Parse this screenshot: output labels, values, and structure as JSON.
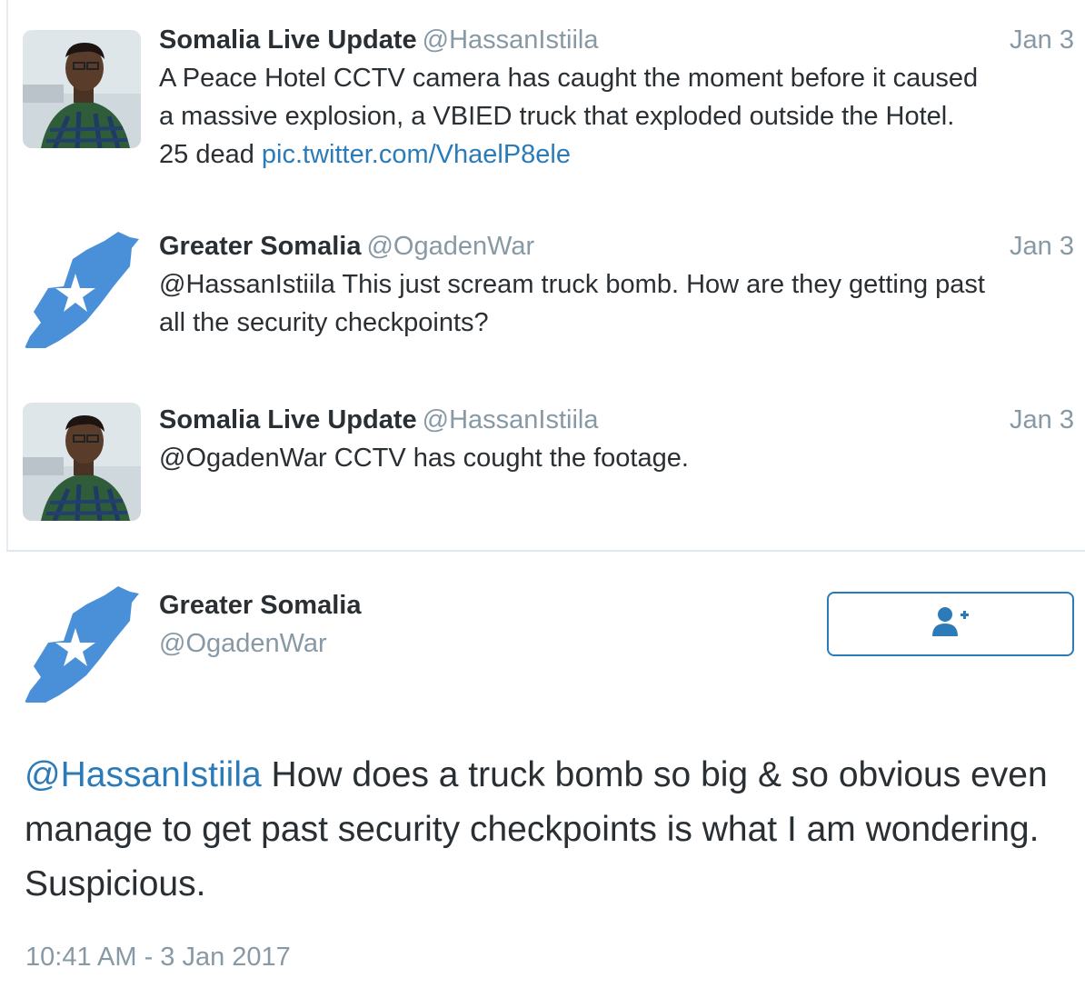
{
  "thread": [
    {
      "name": "Somalia Live Update",
      "handle": "@HassanIstiila",
      "date": "Jan 3",
      "text_lines": [
        "A Peace Hotel CCTV camera has caught the moment before it caused",
        "a massive explosion, a VBIED truck that exploded outside the Hotel.",
        "25 dead "
      ],
      "link": "pic.twitter.com/VhaelP8ele",
      "avatar": "user-photo-avatar"
    },
    {
      "name": "Greater Somalia",
      "handle": "@OgadenWar",
      "date": "Jan 3",
      "text_lines": [
        "@HassanIstiila This just scream truck bomb. How are they getting past",
        "all the security checkpoints?"
      ],
      "avatar": "somalia-map-flag-avatar"
    },
    {
      "name": "Somalia Live Update",
      "handle": "@HassanIstiila",
      "date": "Jan 3",
      "text_lines": [
        "@OgadenWar CCTV has cought the footage."
      ],
      "avatar": "user-photo-avatar"
    }
  ],
  "main_tweet": {
    "name": "Greater Somalia",
    "handle": "@OgadenWar",
    "mention": "@HassanIstiila",
    "text": " How does a truck bomb so big & so obvious even manage to get past security checkpoints is what I am wondering. Suspicious.",
    "timestamp": "10:41 AM - 3 Jan 2017",
    "follow_icon": "add-user-icon"
  },
  "colors": {
    "link": "#2b7bb9",
    "muted": "#8899a6",
    "text": "#292f33",
    "map_blue": "#4a90d9"
  }
}
